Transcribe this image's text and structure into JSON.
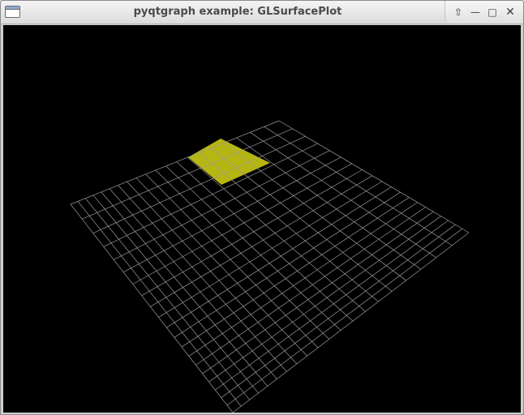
{
  "window": {
    "title": "pyqtgraph example: GLSurfacePlot"
  },
  "icons": {
    "app": "window-icon",
    "shade": "arrow-up-icon",
    "minimize": "minimize-icon",
    "maximize": "maximize-icon",
    "close": "close-icon"
  },
  "scene": {
    "background": "#000000",
    "grid_color": "#9a9a9a",
    "grid_divisions": 20,
    "surface_color": "#b6b613",
    "surface_grid_cells": {
      "i0": 10,
      "i1": 15,
      "j0": 0,
      "j1": 5
    }
  }
}
